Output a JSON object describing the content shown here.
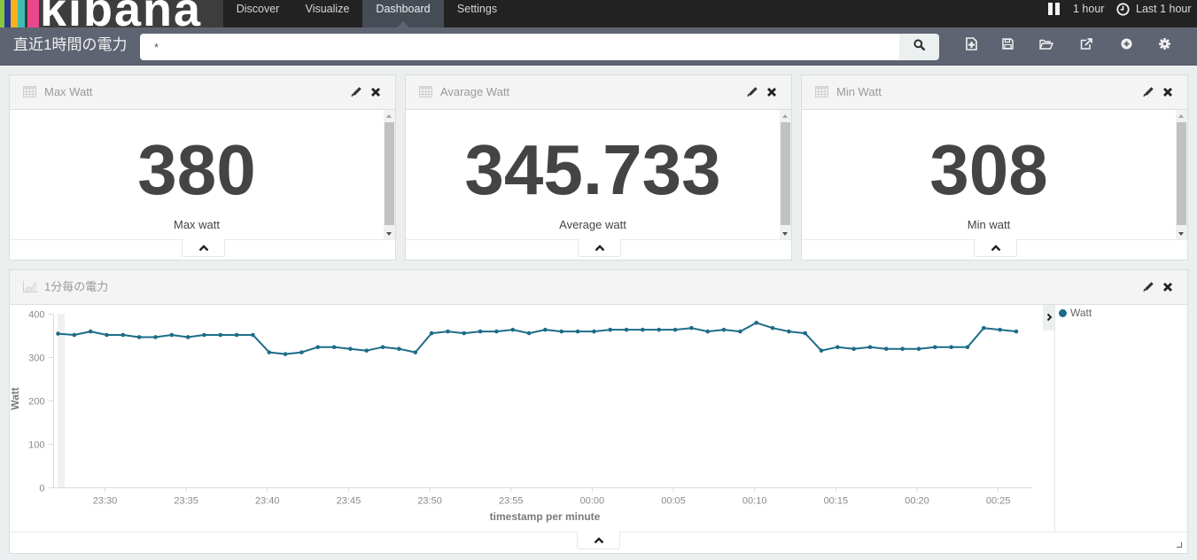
{
  "app": {
    "logo_text": "kibana",
    "logo_colors": [
      "#8cc63f",
      "#2b3990",
      "#f7b21c",
      "#3ebdb2",
      "#e8488b"
    ]
  },
  "nav": {
    "tabs": [
      {
        "label": "Discover",
        "active": false
      },
      {
        "label": "Visualize",
        "active": false
      },
      {
        "label": "Dashboard",
        "active": true
      },
      {
        "label": "Settings",
        "active": false
      }
    ],
    "refresh_interval": "1 hour",
    "time_range": "Last 1 hour"
  },
  "subheader": {
    "dashboard_title": "直近1時間の電力",
    "query": "*",
    "toolbar": [
      {
        "name": "new-dashboard",
        "icon": "new-dashboard-icon"
      },
      {
        "name": "save-dashboard",
        "icon": "save-icon"
      },
      {
        "name": "open-dashboard",
        "icon": "folder-open-icon"
      },
      {
        "name": "share",
        "icon": "share-icon"
      },
      {
        "name": "add-visualization",
        "icon": "add-icon"
      },
      {
        "name": "options",
        "icon": "gear-icon"
      }
    ]
  },
  "panels": [
    {
      "title": "Max Watt",
      "value": "380",
      "label": "Max watt"
    },
    {
      "title": "Avarage Watt",
      "value": "345.733",
      "label": "Average watt"
    },
    {
      "title": "Min Watt",
      "value": "308",
      "label": "Min watt"
    }
  ],
  "chart_panel": {
    "title": "1分毎の電力"
  },
  "colors": {
    "series": "#1d6c87",
    "nav_bg": "#222222",
    "subheader_bg": "#5f6472",
    "page_bg": "#eceff0"
  },
  "chart_data": {
    "type": "line",
    "title": "1分毎の電力",
    "xlabel": "timestamp per minute",
    "ylabel": "Watt",
    "ylim": [
      0,
      400
    ],
    "y_ticks": [
      "0",
      "100",
      "200",
      "300",
      "400"
    ],
    "y_tick_values": [
      0,
      100,
      200,
      300,
      400
    ],
    "x_ticks": [
      "23:30",
      "23:35",
      "23:40",
      "23:45",
      "23:50",
      "23:55",
      "00:00",
      "00:05",
      "00:10",
      "00:15",
      "00:20",
      "00:25"
    ],
    "grid": false,
    "legend": {
      "position": "right",
      "entries": [
        "Watt"
      ]
    },
    "x": [
      "23:27",
      "23:28",
      "23:29",
      "23:30",
      "23:31",
      "23:32",
      "23:33",
      "23:34",
      "23:35",
      "23:36",
      "23:37",
      "23:38",
      "23:39",
      "23:40",
      "23:41",
      "23:42",
      "23:43",
      "23:44",
      "23:45",
      "23:46",
      "23:47",
      "23:48",
      "23:49",
      "23:50",
      "23:51",
      "23:52",
      "23:53",
      "23:54",
      "23:55",
      "23:56",
      "23:57",
      "23:58",
      "23:59",
      "00:00",
      "00:01",
      "00:02",
      "00:03",
      "00:04",
      "00:05",
      "00:06",
      "00:07",
      "00:08",
      "00:09",
      "00:10",
      "00:11",
      "00:12",
      "00:13",
      "00:14",
      "00:15",
      "00:16",
      "00:17",
      "00:18",
      "00:19",
      "00:20",
      "00:21",
      "00:22",
      "00:23",
      "00:24",
      "00:25",
      "00:26"
    ],
    "series": [
      {
        "name": "Watt",
        "values": [
          355,
          352,
          360,
          352,
          352,
          347,
          347,
          352,
          347,
          352,
          352,
          352,
          352,
          312,
          308,
          312,
          324,
          324,
          320,
          316,
          324,
          320,
          312,
          356,
          360,
          356,
          360,
          360,
          364,
          356,
          364,
          360,
          360,
          360,
          364,
          364,
          364,
          364,
          364,
          368,
          360,
          364,
          360,
          380,
          368,
          360,
          356,
          316,
          324,
          320,
          324,
          320,
          320,
          320,
          324,
          324,
          324,
          368,
          364,
          360
        ]
      }
    ]
  }
}
